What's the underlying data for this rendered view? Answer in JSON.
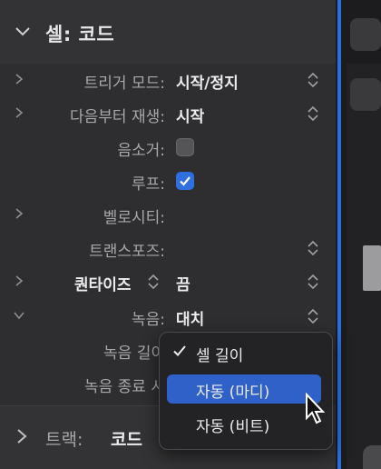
{
  "header": {
    "title": "셀: 코드"
  },
  "rows": [
    {
      "label": "트리거 모드:",
      "value": "시작/정지"
    },
    {
      "label": "다음부터 재생:",
      "value": "시작"
    },
    {
      "label": "음소거:"
    },
    {
      "label": "루프:"
    },
    {
      "label": "벨로시티:"
    },
    {
      "label": "트랜스포즈:"
    },
    {
      "label": "퀀타이즈",
      "value": "끔"
    },
    {
      "label": "녹음:",
      "value": "대치"
    },
    {
      "label": "녹음 길이"
    },
    {
      "label": "녹음 종료 시"
    }
  ],
  "checkboxes": {
    "mute": false,
    "loop": true
  },
  "popup": {
    "items": [
      {
        "label": "셀 길이",
        "checked": true
      },
      {
        "label": "자동 (마디)",
        "highlighted": true
      },
      {
        "label": "자동 (비트)"
      }
    ]
  },
  "track": {
    "label": "트랙:",
    "value": "코드"
  },
  "colors": {
    "accent": "#2f6fe0",
    "highlight": "#2f61c9"
  }
}
